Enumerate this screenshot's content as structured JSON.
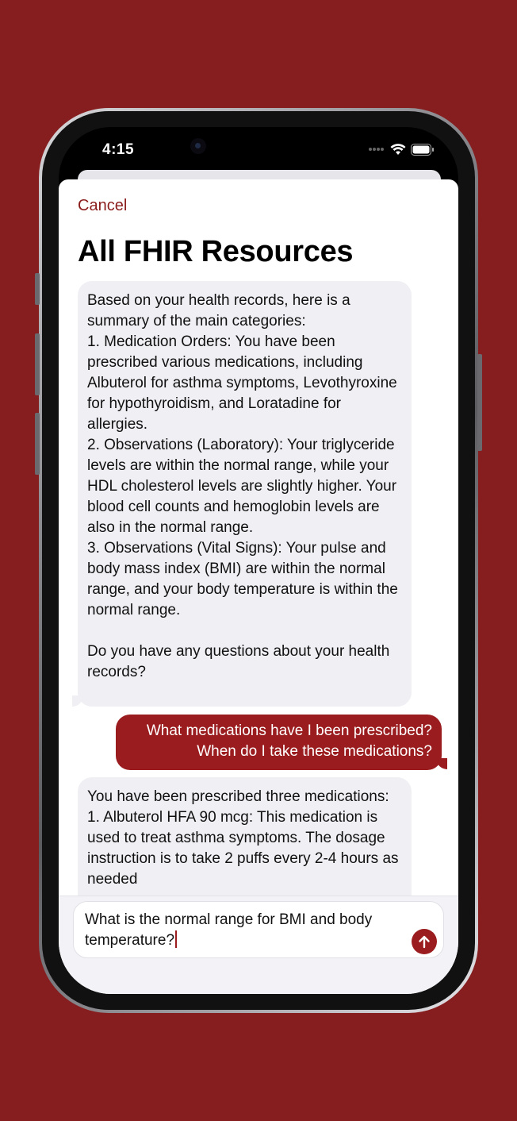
{
  "status_bar": {
    "time": "4:15"
  },
  "sheet": {
    "cancel_label": "Cancel",
    "title": "All FHIR Resources"
  },
  "messages": [
    {
      "role": "assistant",
      "text": "Based on your health records, here is a summary of the main categories:\n1. Medication Orders: You have been prescribed various medications, including Albuterol for asthma symptoms, Levothyroxine for hypothyroidism, and Loratadine for allergies.\n2. Observations (Laboratory): Your triglyceride levels are within the normal range, while your HDL cholesterol levels are slightly higher. Your blood cell counts and hemoglobin levels are also in the normal range.\n3. Observations (Vital Signs): Your pulse and body mass index (BMI) are within the normal range, and your body temperature is within the normal range.\n\nDo you have any questions about your health records?"
    },
    {
      "role": "user",
      "text": "What medications have I been prescribed?\nWhen do I take these medications?"
    },
    {
      "role": "assistant",
      "text": "You have been prescribed three medications:\n1. Albuterol HFA 90 mcg: This medication is used to treat asthma symptoms. The dosage instruction is to take 2 puffs every 2-4 hours as needed"
    }
  ],
  "composer": {
    "value": "What is the normal range for BMI and body temperature?"
  },
  "colors": {
    "background": "#861e1f",
    "accent": "#9b1c1e",
    "assistant_bubble": "#efeff4"
  },
  "icons": {
    "send": "arrow-up-circle-icon",
    "wifi": "wifi-icon",
    "battery": "battery-icon",
    "cellular": "cellular-dots-icon"
  }
}
